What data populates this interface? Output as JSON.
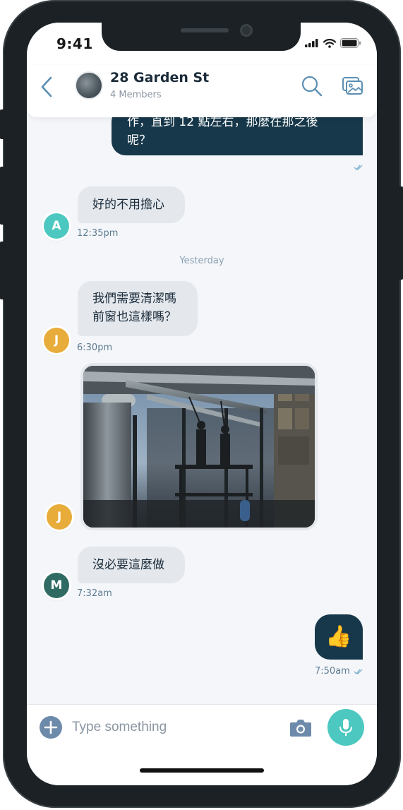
{
  "status_bar": {
    "time": "9:41"
  },
  "header": {
    "title": "28 Garden St",
    "subtitle": "4 Members"
  },
  "messages": {
    "m1_text": "作，直到 12 點左右，那麼在那之後呢？",
    "m1_line1": "作，直到 12 點左右，那麼在那之後",
    "m1_line2": "呢？",
    "m2_text": "好的不用擔心",
    "m2_avatar": "A",
    "m2_time": "12:35pm",
    "day_separator": "Yesterday",
    "m3_line1": "我們需要清潔嗎",
    "m3_line2": "前窗也這樣嗎？",
    "m3_avatar": "J",
    "m3_time": "6:30pm",
    "m4_avatar": "J",
    "m5_text": "沒必要這麼做",
    "m5_avatar": "M",
    "m5_time": "7:32am",
    "m6_emoji": "👍",
    "m6_time": "7:50am"
  },
  "composer": {
    "placeholder": "Type something"
  },
  "colors": {
    "outgoing_bubble": "#17384a",
    "incoming_bubble": "#e4e8ed",
    "avatar_A": "#4cc8c0",
    "avatar_J": "#e8ac3a",
    "avatar_M": "#2f6b62",
    "accent": "#4cc8c0"
  },
  "icons": [
    "back-chevron-icon",
    "search-icon",
    "gallery-icon",
    "plus-icon",
    "camera-icon",
    "microphone-icon",
    "read-receipt-icon"
  ]
}
